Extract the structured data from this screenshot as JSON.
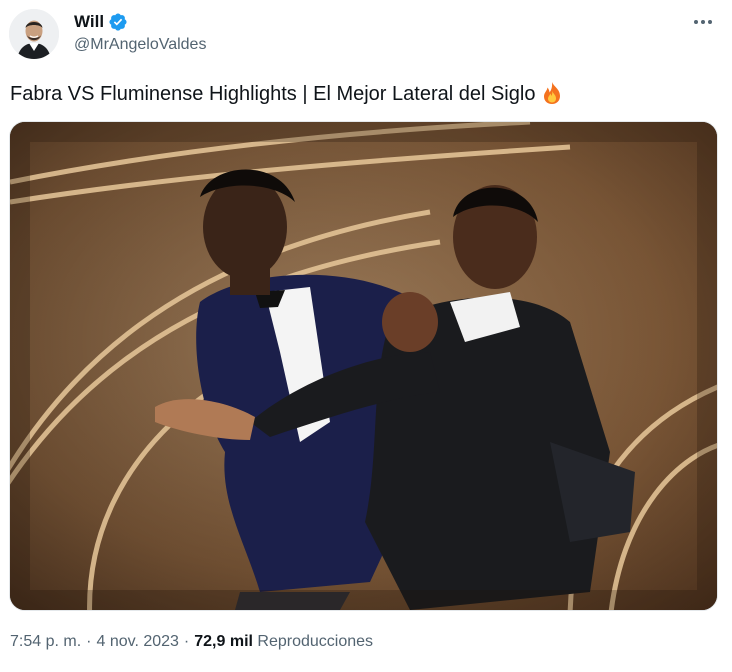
{
  "author": {
    "name": "Will",
    "handle": "@MrAngeloValdes",
    "verified": true
  },
  "tweet": {
    "text": "Fabra VS Fluminense Highlights | El Mejor Lateral del Siglo",
    "emoji_icon": "fire-icon"
  },
  "media": {
    "image": "photo of two men in tuxedos on a stage, one striking the other"
  },
  "meta": {
    "time": "7:54 p. m.",
    "date": "4 nov. 2023",
    "separator": "·",
    "views_count": "72,9 mil",
    "views_label": "Reproducciones"
  },
  "colors": {
    "verified_blue": "#1d9bf0",
    "secondary_text": "#536471",
    "primary_text": "#0f1419"
  }
}
